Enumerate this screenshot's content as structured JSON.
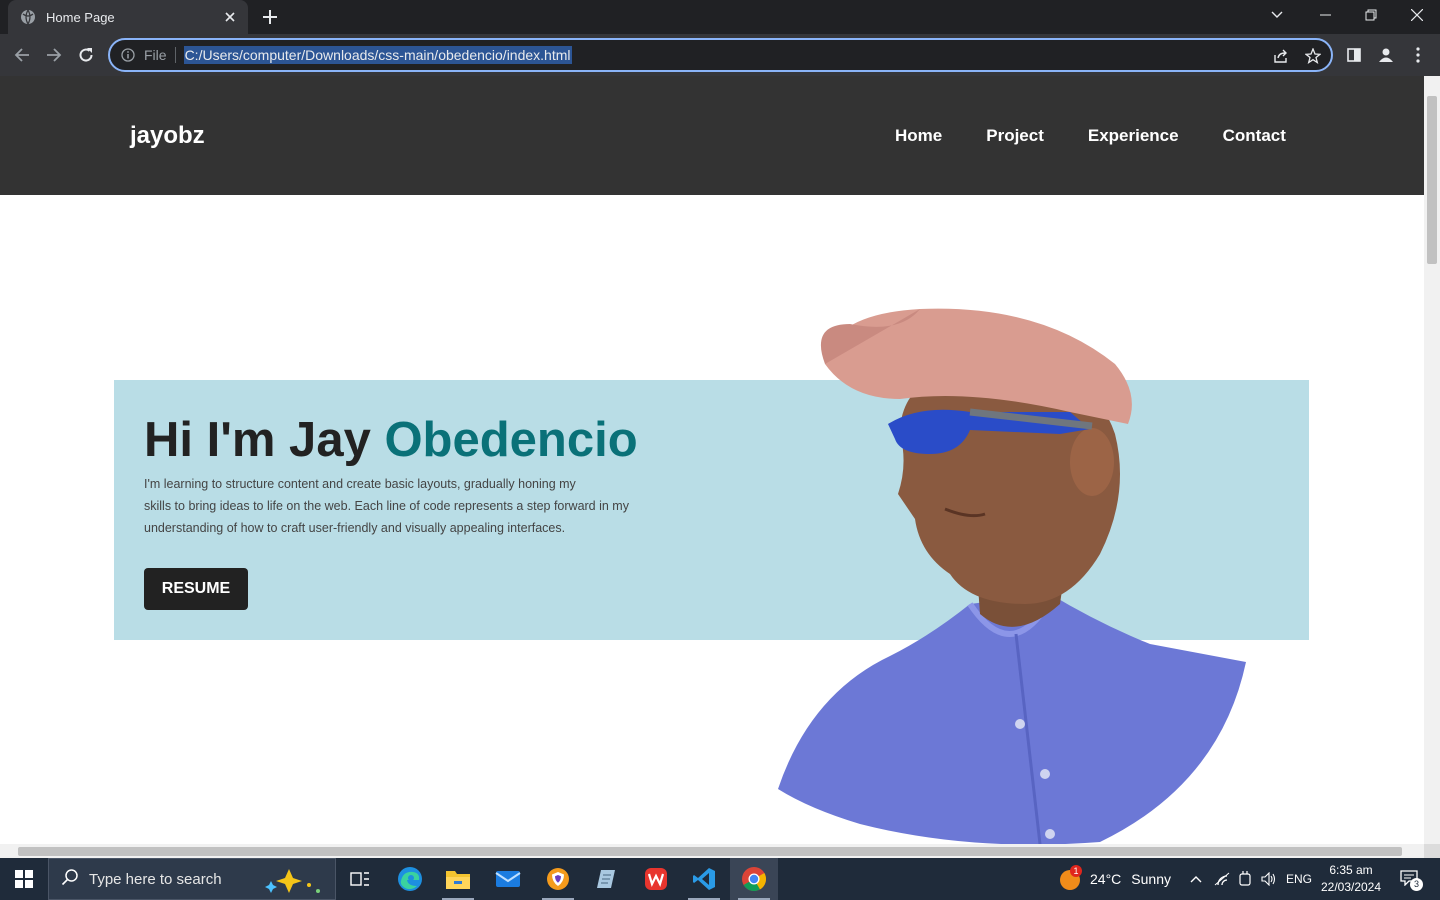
{
  "browser": {
    "tab_title": "Home Page",
    "omnibox_scheme": "File",
    "url": "C:/Users/computer/Downloads/css-main/obedencio/index.html"
  },
  "site": {
    "logo": "jayobz",
    "nav": [
      "Home",
      "Project",
      "Experience",
      "Contact"
    ],
    "hero": {
      "title_main": "Hi I'm Jay ",
      "title_accent": "Obedencio",
      "text_line1": "I'm learning to structure content and create basic layouts, gradually honing my",
      "text_line2": "skills to bring ideas to life on the web. Each line of code represents a step forward in my",
      "text_line3": "understanding of how to craft user-friendly and visually appealing interfaces.",
      "button": "RESUME"
    },
    "colors": {
      "header_bg": "#333333",
      "hero_bg": "#b9dde6",
      "accent": "#0a7178",
      "button_bg": "#222222"
    }
  },
  "taskbar": {
    "search_placeholder": "Type here to search",
    "weather_temp": "24°C",
    "weather_cond": "Sunny",
    "weather_badge": "1",
    "lang": "ENG",
    "time": "6:35 am",
    "date": "22/03/2024",
    "notification_count": "3"
  }
}
